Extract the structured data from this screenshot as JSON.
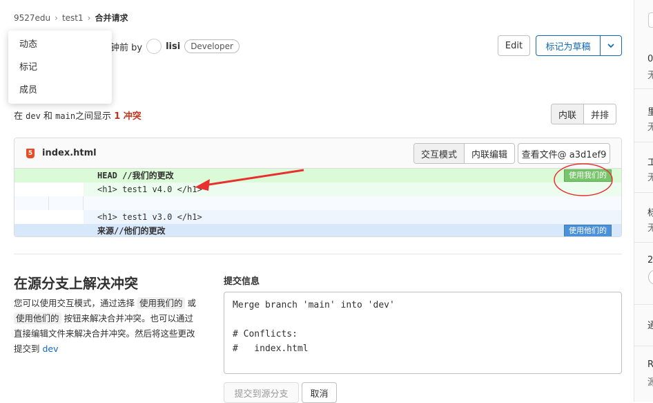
{
  "breadcrumb": {
    "group": "9527edu",
    "project": "test1",
    "current": "合并请求"
  },
  "dropdown": {
    "items": [
      "动态",
      "标记",
      "成员"
    ]
  },
  "meta": {
    "time_by": "钟前 by",
    "author": "lisi",
    "role": "Developer"
  },
  "header_actions": {
    "edit": "Edit",
    "mark_draft": "标记为草稿",
    "caret": "⌄"
  },
  "conflict_summary": {
    "in": "在",
    "source": "dev",
    "and": "和",
    "target": "main",
    "between": "之间显示",
    "count": "1 冲突"
  },
  "view_toggle": {
    "inline": "内联",
    "side_by_side": "并排"
  },
  "file": {
    "name": "index.html",
    "icon_letter": "5",
    "modes": {
      "interactive": "交互模式",
      "inline_edit": "内联编辑"
    },
    "view_file": "查看文件@ a3d1ef9",
    "lines": {
      "ours_head": "HEAD //我们的更改",
      "ours_code": "<h1> test1 v4.0 </h1>",
      "theirs_code": "<h1> test1 v3.0 </h1>",
      "theirs_head": "来源//他们的更改"
    },
    "use_ours": "使用我们的",
    "use_theirs": "使用他们的"
  },
  "resolve": {
    "title": "在源分支上解决冲突",
    "desc_1": "您可以使用交互模式，通过选择",
    "pill_ours": "使用我们的",
    "desc_2": "或",
    "pill_theirs": "使用他们的",
    "desc_3": "按钮来解决合并冲突。也可以通过直接编辑文件来解决合并冲突。然后将这些更改提交到",
    "branch": "dev"
  },
  "commit": {
    "label": "提交信息",
    "message": "Merge branch 'main' into 'dev'\n\n# Conflicts:\n#   index.html",
    "submit": "提交到源分支",
    "cancel": "取消"
  },
  "right_sidebar": {
    "items": [
      "0",
      "无",
      "里",
      "无",
      "工",
      "无",
      "标",
      "无",
      "2",
      "通",
      "R",
      "源"
    ]
  },
  "colors": {
    "accent": "#1068bf",
    "danger": "#c0341d",
    "ours": "#77c56a",
    "theirs": "#4a91d9",
    "annotation": "#e8312f"
  }
}
